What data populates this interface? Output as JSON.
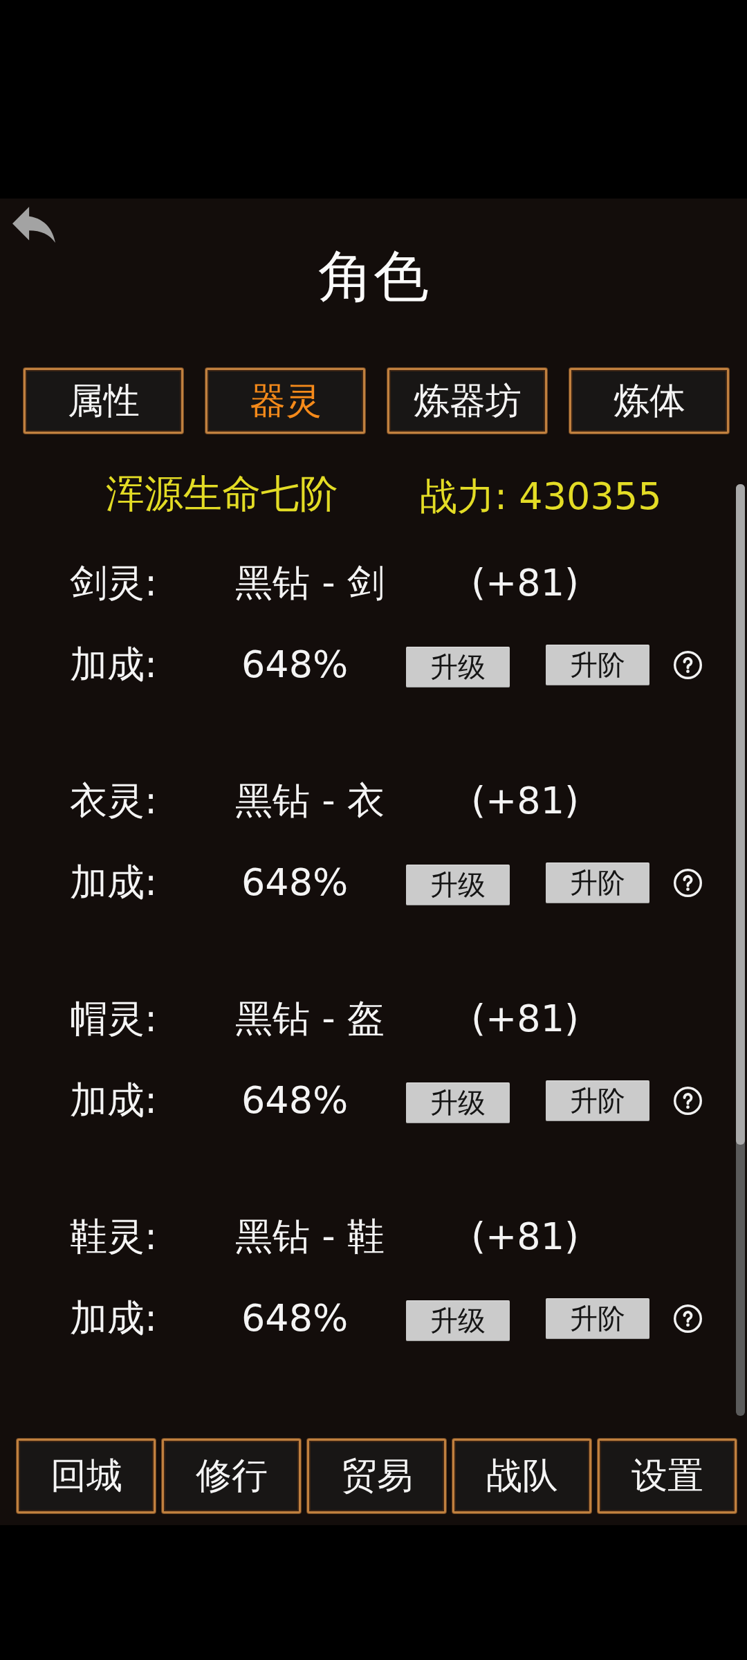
{
  "title": "角色",
  "tabs": [
    {
      "label": "属性",
      "selected": false
    },
    {
      "label": "器灵",
      "selected": true
    },
    {
      "label": "炼器坊",
      "selected": false
    },
    {
      "label": "炼体",
      "selected": false
    }
  ],
  "header": {
    "realm": "浑源生命七阶",
    "power": "战力: 430355"
  },
  "spirits": [
    {
      "label": "剑灵:",
      "equipment": "黑钻 - 剑",
      "enhance": "(+81)",
      "bonus_label": "加成:",
      "bonus_value": "648%",
      "upgrade_button": "升级",
      "advance_button": "升阶"
    },
    {
      "label": "衣灵:",
      "equipment": "黑钻 - 衣",
      "enhance": "(+81)",
      "bonus_label": "加成:",
      "bonus_value": "648%",
      "upgrade_button": "升级",
      "advance_button": "升阶"
    },
    {
      "label": "帽灵:",
      "equipment": "黑钻 - 盔",
      "enhance": "(+81)",
      "bonus_label": "加成:",
      "bonus_value": "648%",
      "upgrade_button": "升级",
      "advance_button": "升阶"
    },
    {
      "label": "鞋灵:",
      "equipment": "黑钻 - 鞋",
      "enhance": "(+81)",
      "bonus_label": "加成:",
      "bonus_value": "648%",
      "upgrade_button": "升级",
      "advance_button": "升阶"
    }
  ],
  "bottom_nav": [
    "回城",
    "修行",
    "贸易",
    "战队",
    "设置"
  ]
}
